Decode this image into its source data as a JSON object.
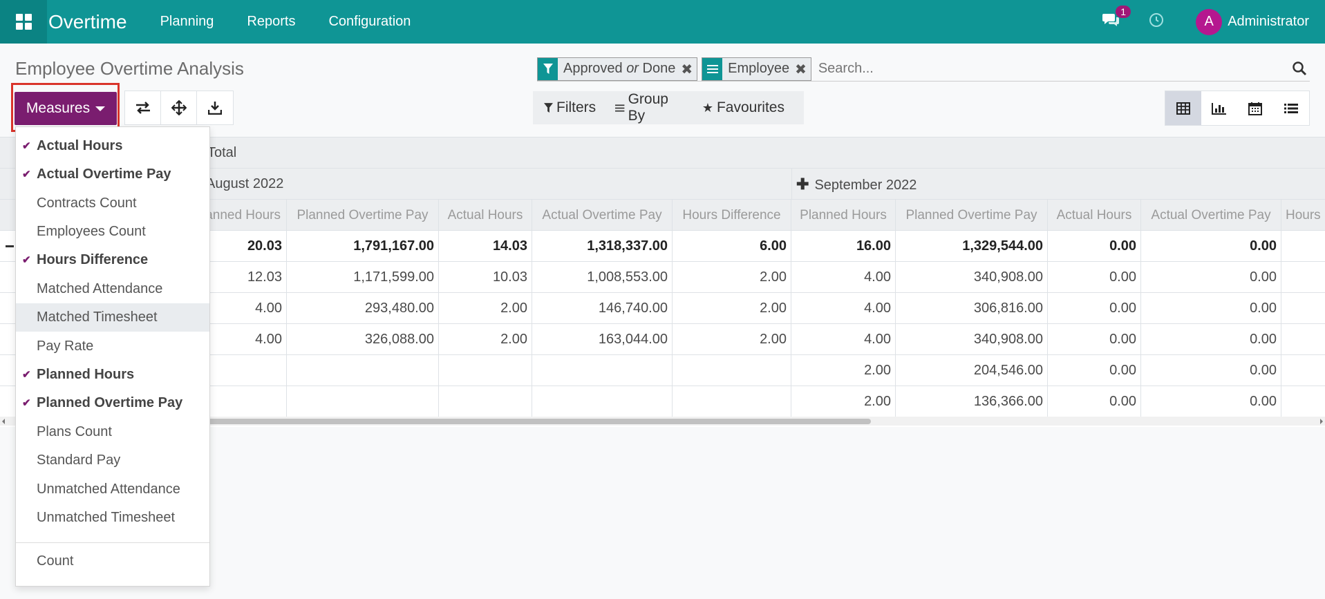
{
  "navbar": {
    "app_title": "Overtime",
    "menu": [
      "Planning",
      "Reports",
      "Configuration"
    ],
    "messages_count": "1",
    "avatar_letter": "A",
    "user_name": "Administrator",
    "brand_color": "#0f9595"
  },
  "page": {
    "title": "Employee Overtime Analysis"
  },
  "search": {
    "facets": [
      {
        "icon": "filter-icon",
        "value_a": "Approved",
        "value_sep": "or",
        "value_b": "Done"
      },
      {
        "icon": "group-by-icon",
        "value": "Employee"
      }
    ],
    "placeholder": "Search..."
  },
  "toolbar": {
    "measures_label": "Measures",
    "tools": [
      "flip-axis-icon",
      "expand-all-icon",
      "download-icon"
    ]
  },
  "filter_bar": {
    "filters": "Filters",
    "group_by": "Group By",
    "favourites": "Favourites"
  },
  "views": [
    "pivot-icon",
    "graph-icon",
    "calendar-icon",
    "list-icon"
  ],
  "measures_menu": {
    "items": [
      {
        "label": "Actual Hours",
        "checked": true
      },
      {
        "label": "Actual Overtime Pay",
        "checked": true
      },
      {
        "label": "Contracts Count",
        "checked": false
      },
      {
        "label": "Employees Count",
        "checked": false
      },
      {
        "label": "Hours Difference",
        "checked": true
      },
      {
        "label": "Matched Attendance",
        "checked": false
      },
      {
        "label": "Matched Timesheet",
        "checked": false
      },
      {
        "label": "Pay Rate",
        "checked": false
      },
      {
        "label": "Planned Hours",
        "checked": true
      },
      {
        "label": "Planned Overtime Pay",
        "checked": true
      },
      {
        "label": "Plans Count",
        "checked": false
      },
      {
        "label": "Standard Pay",
        "checked": false
      },
      {
        "label": "Unmatched Attendance",
        "checked": false
      },
      {
        "label": "Unmatched Timesheet",
        "checked": false
      }
    ],
    "count_label": "Count"
  },
  "pivot": {
    "total_header": "Total",
    "groups": [
      "August 2022",
      "September 2022"
    ],
    "measure_headers": [
      "Planned Hours",
      "Planned Overtime Pay",
      "Actual Hours",
      "Actual Overtime Pay",
      "Hours Difference",
      "Planned Hours",
      "Planned Overtime Pay",
      "Actual Hours",
      "Actual Overtime Pay",
      "Hours"
    ],
    "rows": [
      [
        "20.03",
        "1,791,167.00",
        "14.03",
        "1,318,337.00",
        "6.00",
        "16.00",
        "1,329,544.00",
        "0.00",
        "0.00"
      ],
      [
        "12.03",
        "1,171,599.00",
        "10.03",
        "1,008,553.00",
        "2.00",
        "4.00",
        "340,908.00",
        "0.00",
        "0.00"
      ],
      [
        "4.00",
        "293,480.00",
        "2.00",
        "146,740.00",
        "2.00",
        "4.00",
        "306,816.00",
        "0.00",
        "0.00"
      ],
      [
        "4.00",
        "326,088.00",
        "2.00",
        "163,044.00",
        "2.00",
        "4.00",
        "340,908.00",
        "0.00",
        "0.00"
      ],
      [
        "",
        "",
        "",
        "",
        "",
        "2.00",
        "204,546.00",
        "0.00",
        "0.00"
      ],
      [
        "",
        "",
        "",
        "",
        "",
        "2.00",
        "136,366.00",
        "0.00",
        "0.00"
      ]
    ]
  }
}
